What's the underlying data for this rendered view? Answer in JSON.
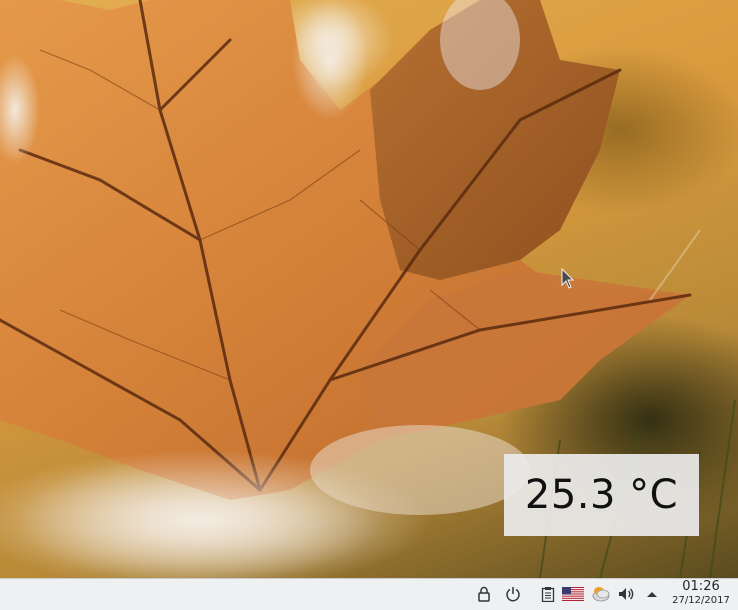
{
  "desktop": {
    "wallpaper": "autumn-maple-leaf",
    "colors": {
      "leaf": "#d9893a",
      "leaf_dark": "#8a4a1c",
      "vein": "#5a2a0e",
      "background": "#e3ae52"
    }
  },
  "widget": {
    "temperature": "25.3 °C"
  },
  "taskbar": {
    "background": "#eff0f1",
    "tray_icons": [
      "lock-icon",
      "power-icon",
      "clipboard-icon",
      "us-flag-icon",
      "weather-icon",
      "volume-icon",
      "expand-tray-icon"
    ],
    "clock": {
      "time": "01:26",
      "date": "27/12/2017"
    }
  }
}
